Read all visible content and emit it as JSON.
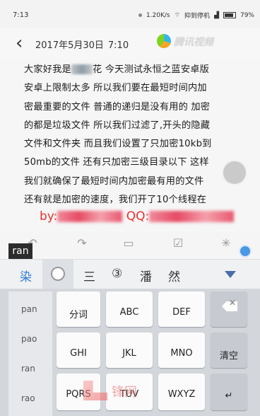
{
  "status_bar": {
    "time": "7:13",
    "speed": "1.20K/s",
    "carrier": "抑到停机",
    "battery": "79%"
  },
  "header": {
    "date": "2017年5月30日",
    "time": "7:10",
    "watermark": "腾讯视频"
  },
  "note": {
    "lines": [
      [
        "大家好我是",
        "",
        "花 今天测试永恒之蓝安卓版"
      ],
      [
        "安卓上限制太多 所以我们要在最短时间内加"
      ],
      [
        "密最重要的文件 普通的递归是没有用的 加密"
      ],
      [
        "的都是垃圾文件 所以我们过滤了,开头的隐藏"
      ],
      [
        "文件和文件夹 而且我们设置了只加密10kb到"
      ],
      [
        "50mb的文件 还有只加密三级目录以下 这样"
      ],
      [
        "我们就确保了最短时间内加密最有用的文件"
      ],
      [
        "还有就是加密的速度，我们开了10个线程在"
      ]
    ],
    "signature_prefix": "by:",
    "signature_qq": "QQ:"
  },
  "ime": {
    "composing": "ran",
    "candidates": [
      "染",
      "三",
      "③",
      "潘",
      "然"
    ]
  },
  "keyboard": {
    "pinyin": [
      "pan",
      "pao",
      "ran",
      "rao"
    ],
    "row1": [
      {
        "d": "",
        "n": "分词"
      },
      {
        "d": "",
        "n": "ABC"
      },
      {
        "d": "",
        "n": "DEF"
      }
    ],
    "row2": [
      {
        "d": "",
        "n": "GHI"
      },
      {
        "d": "",
        "n": "JKL"
      },
      {
        "d": "",
        "n": "MNO"
      }
    ],
    "row3": [
      {
        "d": "",
        "n": "PQRS"
      },
      {
        "d": "",
        "n": "TUV"
      },
      {
        "d": "",
        "n": "WXYZ"
      }
    ],
    "clear": "清空"
  },
  "bottom_watermark": "锋网"
}
